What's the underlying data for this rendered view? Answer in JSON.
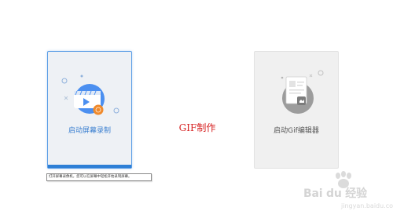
{
  "record_card": {
    "label": "启动屏幕录制",
    "tooltip": "打开屏幕录像机，您可以在屏幕中轻松开始录制屏幕。"
  },
  "gif_card": {
    "label": "启动Gif编辑器"
  },
  "caption": "GIF制作",
  "watermark": {
    "brand": "Bai du 经验",
    "sub": "jingyan.baidu.com"
  },
  "colors": {
    "accent": "#2d7fd6",
    "caption": "#d61f1f",
    "record_icon": "#4b8ff0",
    "record_badge": "#f08a2c"
  },
  "icons": [
    "video-camera-icon",
    "image-document-icon",
    "baidu-paw-icon"
  ]
}
